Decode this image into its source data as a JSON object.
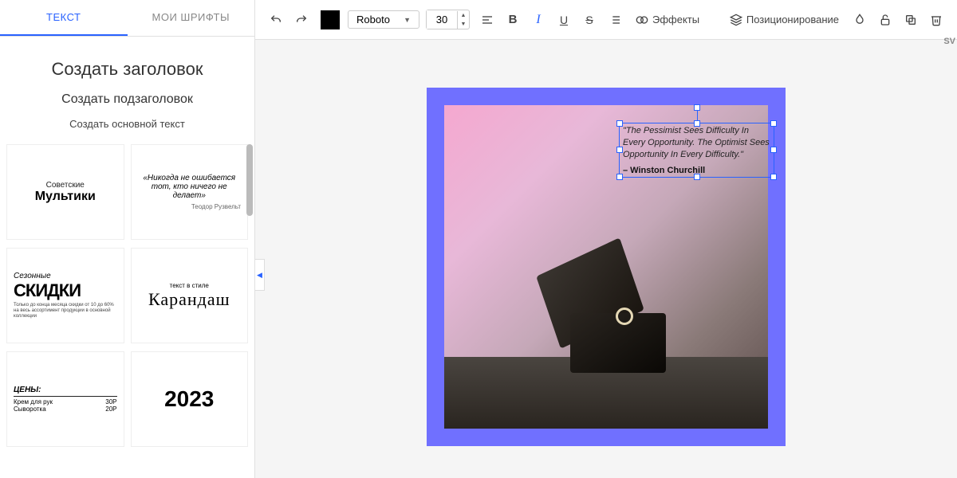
{
  "sidebar": {
    "tabs": {
      "text": "ТЕКСТ",
      "fonts": "МОИ ШРИФТЫ"
    },
    "create": {
      "heading": "Создать заголовок",
      "subheading": "Создать подзаголовок",
      "body": "Создать основной текст"
    },
    "templates": {
      "soviet": {
        "sub": "Советские",
        "main": "Мультики"
      },
      "quote": {
        "text": "«Никогда не ошибается тот, кто ничего не делает»",
        "author": "Теодор Рузвельт"
      },
      "skidki": {
        "season": "Сезонные",
        "main": "СКИДКИ",
        "sub": "Только до конца месяца скидки от 10 до 60% на весь ассортимент продукции в основной коллекции"
      },
      "pencil": {
        "sub": "текст в стиле",
        "main": "Карандаш"
      },
      "prices": {
        "header": "ЦЕНЫ:",
        "rows": [
          {
            "name": "Крем для рук",
            "price": "30Р"
          },
          {
            "name": "Сыворотка",
            "price": "20Р"
          }
        ]
      },
      "year": "2023"
    }
  },
  "toolbar": {
    "font": "Roboto",
    "size": "30",
    "effects": "Эффекты",
    "positioning": "Позиционирование",
    "color": "#000000"
  },
  "canvas": {
    "quote": "\"The Pessimist Sees Difficulty In Every Opportunity. The Optimist Sees Opportunity In Every Difficulty.\"",
    "author": "– Winston Churchill"
  },
  "right_label": "SV"
}
